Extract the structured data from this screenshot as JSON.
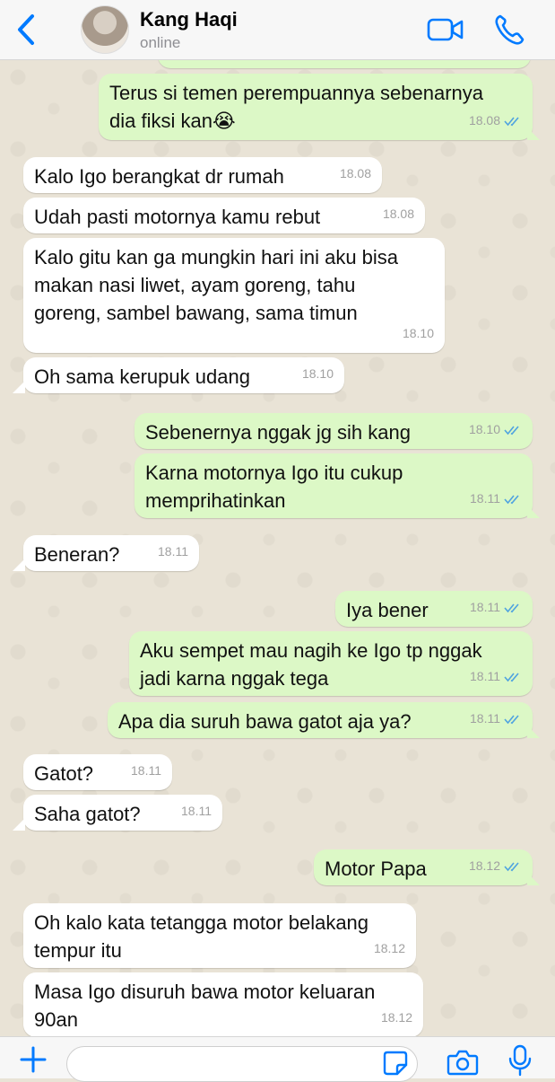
{
  "header": {
    "contact_name": "Kang Haqi",
    "status": "online",
    "accent_color": "#007aff"
  },
  "messages": [
    {
      "dir": "out",
      "text": "",
      "time": "18.08"
    },
    {
      "dir": "out",
      "text": "Terus si temen perempuannya sebenarnya\ndia fiksi kan😭",
      "time": "18.08"
    },
    {
      "dir": "in",
      "text": "Kalo Igo berangkat dr rumah",
      "time": "18.08"
    },
    {
      "dir": "in",
      "text": "Udah pasti motornya kamu rebut",
      "time": "18.08"
    },
    {
      "dir": "in",
      "text": "Kalo gitu kan ga mungkin hari ini aku bisa\nmakan nasi liwet, ayam goreng, tahu\ngoreng, sambel bawang, sama timun",
      "time": "18.10"
    },
    {
      "dir": "in",
      "text": "Oh sama kerupuk udang",
      "time": "18.10"
    },
    {
      "dir": "out",
      "text": "Sebenernya nggak jg sih kang",
      "time": "18.10"
    },
    {
      "dir": "out",
      "text": "Karna motornya Igo itu cukup\nmemprihatinkan",
      "time": "18.11"
    },
    {
      "dir": "in",
      "text": "Beneran?",
      "time": "18.11"
    },
    {
      "dir": "out",
      "text": "Iya bener",
      "time": "18.11"
    },
    {
      "dir": "out",
      "text": "Aku sempet mau nagih ke Igo tp nggak\njadi karna nggak tega",
      "time": "18.11"
    },
    {
      "dir": "out",
      "text": "Apa dia suruh bawa gatot aja ya?",
      "time": "18.11"
    },
    {
      "dir": "in",
      "text": "Gatot?",
      "time": "18.11"
    },
    {
      "dir": "in",
      "text": "Saha gatot?",
      "time": "18.11"
    },
    {
      "dir": "out",
      "text": "Motor Papa",
      "time": "18.12"
    },
    {
      "dir": "in",
      "text": "Oh kalo kata tetangga motor belakang\ntempur itu",
      "time": "18.12"
    },
    {
      "dir": "in",
      "text": "Masa Igo disuruh bawa motor keluaran\n90an",
      "time": "18.12"
    }
  ],
  "colors": {
    "incoming_bubble": "#ffffff",
    "outgoing_bubble": "#dcf8c6",
    "read_ticks": "#4fa3e0",
    "wallpaper": "#e9e3d6"
  },
  "icons": [
    "back-chevron-icon",
    "video-call-icon",
    "phone-icon",
    "plus-icon",
    "sticker-icon",
    "camera-icon",
    "microphone-icon",
    "double-check-icon"
  ]
}
